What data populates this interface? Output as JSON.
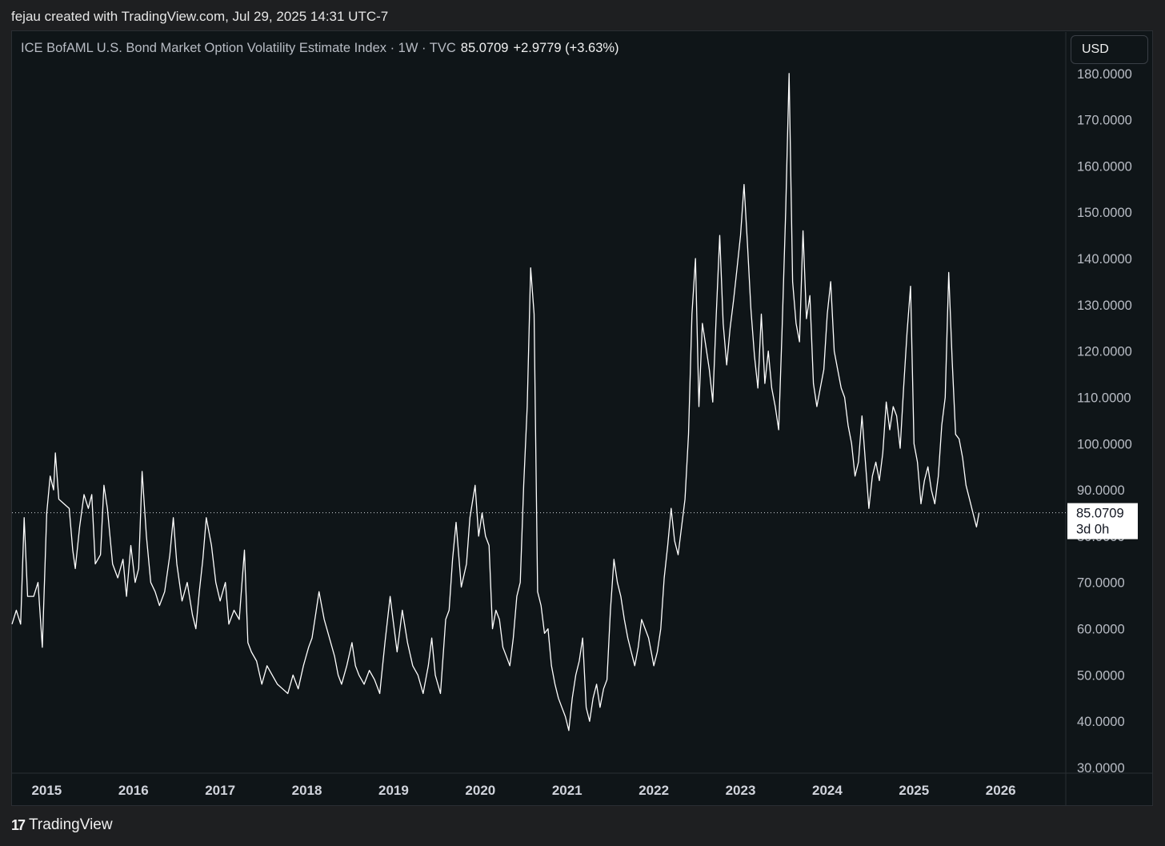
{
  "header": {
    "credit": "fejau created with TradingView.com, Jul 29, 2025 14:31 UTC-7"
  },
  "legend": {
    "title": "ICE BofAML U.S. Bond Market Option Volatility Estimate Index · 1W · TVC",
    "last": "85.0709",
    "change": "+2.9779 (+3.63%)"
  },
  "currency": "USD",
  "price_label": {
    "value": "85.0709",
    "countdown": "3d 0h"
  },
  "footer": {
    "brand": "TradingView",
    "logo_icon": "tradingview-logo-icon"
  },
  "colors": {
    "background": "#0f1518",
    "line": "#ffffff",
    "label_bg": "#ffffff"
  },
  "chart_data": {
    "type": "line",
    "title": "ICE BofAML U.S. Bond Market Option Volatility Estimate Index · 1W · TVC",
    "xlabel": "",
    "ylabel": "",
    "x_tick_labels": [
      "2015",
      "2016",
      "2017",
      "2018",
      "2019",
      "2020",
      "2021",
      "2022",
      "2023",
      "2024",
      "2025",
      "2026"
    ],
    "y_tick_labels": [
      "30.0000",
      "40.0000",
      "50.0000",
      "60.0000",
      "70.0000",
      "80.0000",
      "90.0000",
      "100.0000",
      "110.0000",
      "120.0000",
      "130.0000",
      "140.0000",
      "150.0000",
      "160.0000",
      "170.0000",
      "180.0000"
    ],
    "xlim": [
      2014.6,
      2026.75
    ],
    "ylim": [
      30,
      181
    ],
    "last_value": 85.0709,
    "grid": false,
    "series": [
      {
        "values": [
          [
            2014.6,
            61
          ],
          [
            2014.65,
            64
          ],
          [
            2014.7,
            61
          ],
          [
            2014.74,
            84
          ],
          [
            2014.78,
            67
          ],
          [
            2014.85,
            67
          ],
          [
            2014.9,
            70
          ],
          [
            2014.95,
            56
          ],
          [
            2015.0,
            85
          ],
          [
            2015.04,
            93
          ],
          [
            2015.08,
            90
          ],
          [
            2015.1,
            98
          ],
          [
            2015.14,
            88
          ],
          [
            2015.2,
            87
          ],
          [
            2015.26,
            86
          ],
          [
            2015.3,
            77
          ],
          [
            2015.33,
            73
          ],
          [
            2015.38,
            82
          ],
          [
            2015.43,
            89
          ],
          [
            2015.48,
            86
          ],
          [
            2015.52,
            89
          ],
          [
            2015.56,
            74
          ],
          [
            2015.62,
            76
          ],
          [
            2015.66,
            91
          ],
          [
            2015.7,
            86
          ],
          [
            2015.76,
            74
          ],
          [
            2015.82,
            71
          ],
          [
            2015.88,
            75
          ],
          [
            2015.92,
            67
          ],
          [
            2015.97,
            78
          ],
          [
            2016.02,
            70
          ],
          [
            2016.06,
            73
          ],
          [
            2016.1,
            94
          ],
          [
            2016.15,
            80
          ],
          [
            2016.2,
            70
          ],
          [
            2016.25,
            68
          ],
          [
            2016.3,
            65
          ],
          [
            2016.36,
            68
          ],
          [
            2016.42,
            76
          ],
          [
            2016.46,
            84
          ],
          [
            2016.5,
            74
          ],
          [
            2016.56,
            66
          ],
          [
            2016.62,
            70
          ],
          [
            2016.68,
            63
          ],
          [
            2016.72,
            60
          ],
          [
            2016.76,
            68
          ],
          [
            2016.8,
            75
          ],
          [
            2016.84,
            84
          ],
          [
            2016.9,
            78
          ],
          [
            2016.95,
            70
          ],
          [
            2017.0,
            66
          ],
          [
            2017.06,
            70
          ],
          [
            2017.1,
            61
          ],
          [
            2017.16,
            64
          ],
          [
            2017.22,
            62
          ],
          [
            2017.28,
            77
          ],
          [
            2017.32,
            57
          ],
          [
            2017.36,
            55
          ],
          [
            2017.42,
            53
          ],
          [
            2017.48,
            48
          ],
          [
            2017.54,
            52
          ],
          [
            2017.6,
            50
          ],
          [
            2017.66,
            48
          ],
          [
            2017.72,
            47
          ],
          [
            2017.78,
            46
          ],
          [
            2017.84,
            50
          ],
          [
            2017.9,
            47
          ],
          [
            2017.96,
            52
          ],
          [
            2018.02,
            56
          ],
          [
            2018.06,
            58
          ],
          [
            2018.1,
            63
          ],
          [
            2018.14,
            68
          ],
          [
            2018.2,
            62
          ],
          [
            2018.26,
            58
          ],
          [
            2018.32,
            54
          ],
          [
            2018.36,
            50
          ],
          [
            2018.4,
            48
          ],
          [
            2018.46,
            52
          ],
          [
            2018.52,
            57
          ],
          [
            2018.56,
            52
          ],
          [
            2018.6,
            50
          ],
          [
            2018.66,
            48
          ],
          [
            2018.72,
            51
          ],
          [
            2018.78,
            49
          ],
          [
            2018.84,
            46
          ],
          [
            2018.9,
            57
          ],
          [
            2018.96,
            67
          ],
          [
            2019.0,
            61
          ],
          [
            2019.04,
            55
          ],
          [
            2019.1,
            64
          ],
          [
            2019.16,
            57
          ],
          [
            2019.22,
            52
          ],
          [
            2019.28,
            50
          ],
          [
            2019.34,
            46
          ],
          [
            2019.4,
            52
          ],
          [
            2019.44,
            58
          ],
          [
            2019.48,
            50
          ],
          [
            2019.54,
            46
          ],
          [
            2019.6,
            62
          ],
          [
            2019.64,
            64
          ],
          [
            2019.68,
            75
          ],
          [
            2019.72,
            83
          ],
          [
            2019.78,
            69
          ],
          [
            2019.84,
            74
          ],
          [
            2019.88,
            84
          ],
          [
            2019.94,
            91
          ],
          [
            2019.98,
            80
          ],
          [
            2020.02,
            85
          ],
          [
            2020.06,
            80
          ],
          [
            2020.1,
            78
          ],
          [
            2020.14,
            60
          ],
          [
            2020.18,
            64
          ],
          [
            2020.22,
            62
          ],
          [
            2020.26,
            56
          ],
          [
            2020.3,
            54
          ],
          [
            2020.34,
            52
          ],
          [
            2020.38,
            58
          ],
          [
            2020.42,
            67
          ],
          [
            2020.46,
            70
          ],
          [
            2020.5,
            91
          ],
          [
            2020.54,
            108
          ],
          [
            2020.58,
            138
          ],
          [
            2020.62,
            128
          ],
          [
            2020.66,
            68
          ],
          [
            2020.7,
            65
          ],
          [
            2020.74,
            59
          ],
          [
            2020.78,
            60
          ],
          [
            2020.82,
            52
          ],
          [
            2020.86,
            48
          ],
          [
            2020.9,
            45
          ],
          [
            2020.94,
            43
          ],
          [
            2020.98,
            41
          ],
          [
            2021.02,
            38
          ],
          [
            2021.06,
            45
          ],
          [
            2021.1,
            50
          ],
          [
            2021.14,
            53
          ],
          [
            2021.18,
            58
          ],
          [
            2021.22,
            43
          ],
          [
            2021.26,
            40
          ],
          [
            2021.3,
            45
          ],
          [
            2021.34,
            48
          ],
          [
            2021.38,
            43
          ],
          [
            2021.42,
            47
          ],
          [
            2021.46,
            49
          ],
          [
            2021.5,
            64
          ],
          [
            2021.54,
            75
          ],
          [
            2021.58,
            70
          ],
          [
            2021.62,
            67
          ],
          [
            2021.66,
            62
          ],
          [
            2021.7,
            58
          ],
          [
            2021.74,
            55
          ],
          [
            2021.78,
            52
          ],
          [
            2021.82,
            56
          ],
          [
            2021.86,
            62
          ],
          [
            2021.9,
            60
          ],
          [
            2021.94,
            58
          ],
          [
            2021.98,
            54
          ],
          [
            2022.0,
            52
          ],
          [
            2022.04,
            55
          ],
          [
            2022.08,
            60
          ],
          [
            2022.12,
            71
          ],
          [
            2022.16,
            78
          ],
          [
            2022.2,
            86
          ],
          [
            2022.24,
            79
          ],
          [
            2022.28,
            76
          ],
          [
            2022.32,
            82
          ],
          [
            2022.36,
            88
          ],
          [
            2022.4,
            102
          ],
          [
            2022.44,
            128
          ],
          [
            2022.48,
            140
          ],
          [
            2022.52,
            108
          ],
          [
            2022.56,
            126
          ],
          [
            2022.6,
            121
          ],
          [
            2022.64,
            116
          ],
          [
            2022.68,
            109
          ],
          [
            2022.72,
            128
          ],
          [
            2022.76,
            145
          ],
          [
            2022.8,
            126
          ],
          [
            2022.84,
            117
          ],
          [
            2022.88,
            125
          ],
          [
            2022.92,
            131
          ],
          [
            2022.96,
            138
          ],
          [
            2023.0,
            145
          ],
          [
            2023.04,
            156
          ],
          [
            2023.08,
            143
          ],
          [
            2023.12,
            129
          ],
          [
            2023.16,
            119
          ],
          [
            2023.2,
            112
          ],
          [
            2023.24,
            128
          ],
          [
            2023.28,
            113
          ],
          [
            2023.32,
            120
          ],
          [
            2023.36,
            112
          ],
          [
            2023.4,
            108
          ],
          [
            2023.44,
            103
          ],
          [
            2023.48,
            125
          ],
          [
            2023.52,
            150
          ],
          [
            2023.56,
            180
          ],
          [
            2023.6,
            135
          ],
          [
            2023.64,
            126
          ],
          [
            2023.68,
            122
          ],
          [
            2023.72,
            146
          ],
          [
            2023.76,
            127
          ],
          [
            2023.8,
            132
          ],
          [
            2023.84,
            113
          ],
          [
            2023.88,
            108
          ],
          [
            2023.92,
            112
          ],
          [
            2023.96,
            116
          ],
          [
            2024.0,
            128
          ],
          [
            2024.04,
            135
          ],
          [
            2024.08,
            120
          ],
          [
            2024.12,
            116
          ],
          [
            2024.16,
            112
          ],
          [
            2024.2,
            110
          ],
          [
            2024.24,
            104
          ],
          [
            2024.28,
            100
          ],
          [
            2024.32,
            93
          ],
          [
            2024.36,
            96
          ],
          [
            2024.4,
            106
          ],
          [
            2024.44,
            96
          ],
          [
            2024.48,
            86
          ],
          [
            2024.52,
            93
          ],
          [
            2024.56,
            96
          ],
          [
            2024.6,
            92
          ],
          [
            2024.64,
            98
          ],
          [
            2024.68,
            109
          ],
          [
            2024.72,
            103
          ],
          [
            2024.76,
            108
          ],
          [
            2024.8,
            106
          ],
          [
            2024.84,
            99
          ],
          [
            2024.88,
            112
          ],
          [
            2024.92,
            124
          ],
          [
            2024.96,
            134
          ],
          [
            2025.0,
            100
          ],
          [
            2025.04,
            96
          ],
          [
            2025.08,
            87
          ],
          [
            2025.12,
            92
          ],
          [
            2025.16,
            95
          ],
          [
            2025.2,
            90
          ],
          [
            2025.24,
            87
          ],
          [
            2025.28,
            93
          ],
          [
            2025.32,
            104
          ],
          [
            2025.36,
            110
          ],
          [
            2025.4,
            137
          ],
          [
            2025.44,
            118
          ],
          [
            2025.48,
            102
          ],
          [
            2025.52,
            101
          ],
          [
            2025.56,
            97
          ],
          [
            2025.6,
            91
          ],
          [
            2025.64,
            88
          ],
          [
            2025.68,
            85
          ],
          [
            2025.72,
            82
          ],
          [
            2025.75,
            85.07
          ]
        ]
      }
    ]
  }
}
